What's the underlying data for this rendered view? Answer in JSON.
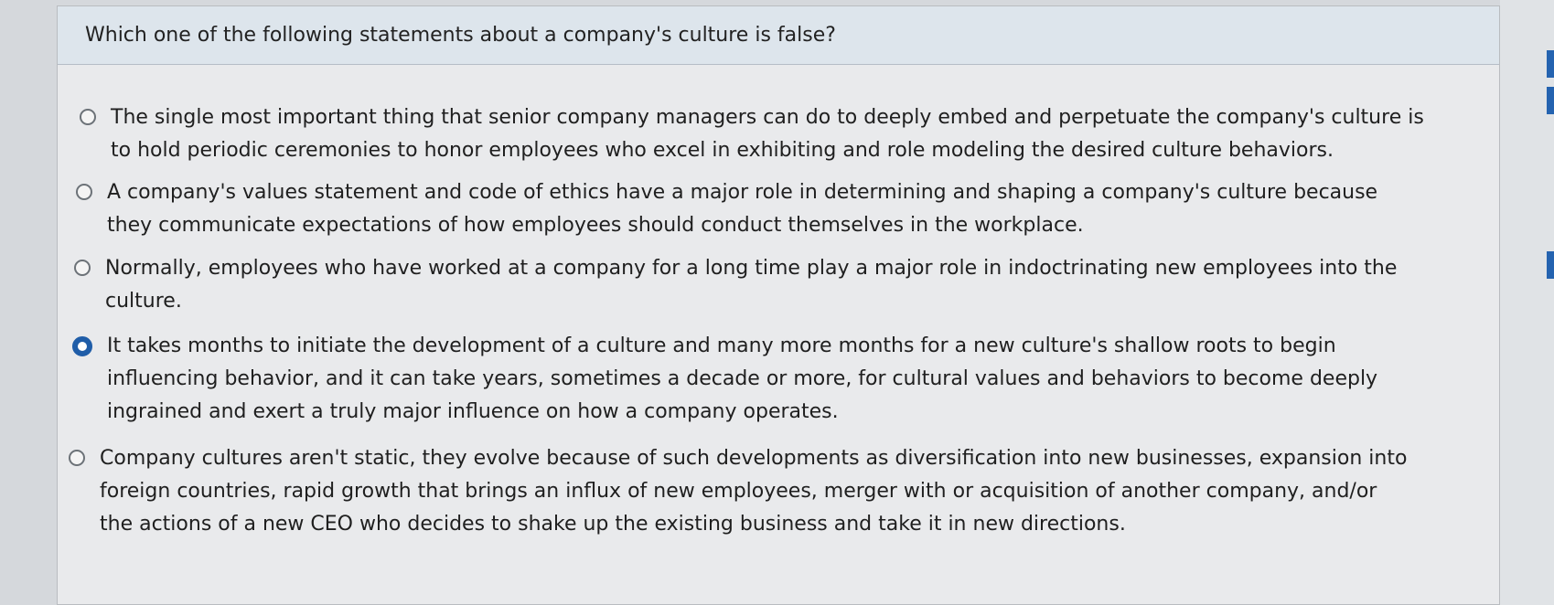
{
  "question": {
    "text": "Which one of the following statements about a company's culture is false?",
    "options": [
      {
        "label": "The single most important thing that senior company managers can do to deeply embed and perpetuate the company's culture is to hold periodic ceremonies to honor employees who excel in exhibiting and role modeling the desired culture behaviors.",
        "selected": false
      },
      {
        "label": "A company's values statement and code of ethics have a major role in determining and shaping a company's culture because they communicate expectations of how employees should conduct themselves in the workplace.",
        "selected": false
      },
      {
        "label": "Normally, employees who have worked at a company for a long time play a major role in indoctrinating new employees into the culture.",
        "selected": false
      },
      {
        "label": "It takes months to initiate the development of a culture and many more months for a new culture's shallow roots to begin influencing behavior, and it can take years, sometimes a decade or more, for cultural values and behaviors to become deeply ingrained and exert a truly major influence on how a company operates.",
        "selected": true
      },
      {
        "label": "Company cultures aren't static, they evolve because of such developments as diversification into new businesses, expansion into foreign countries, rapid growth that brings an influx of new employees, merger with or acquisition of another company, and/or the actions of a new CEO who decides to shake up the existing business and take it in new directions.",
        "selected": false
      }
    ]
  },
  "colors": {
    "selected_radio": "#1f5da8",
    "header_bg": "#dde5ec",
    "panel_bg": "#e9eaec"
  }
}
